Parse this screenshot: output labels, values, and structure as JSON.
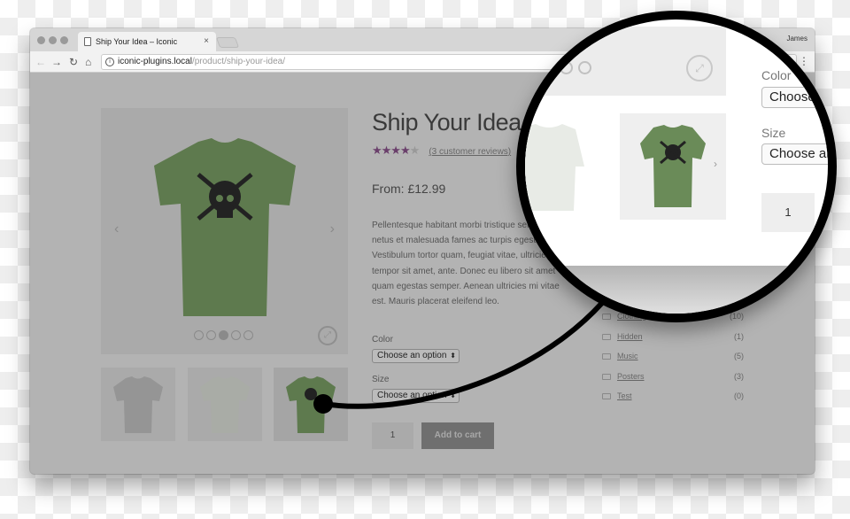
{
  "browser": {
    "tab_title": "Ship Your Idea – Iconic",
    "tab_close": "×",
    "profile_name": "James",
    "url_host": "iconic-plugins.local",
    "url_path": "/product/ship-your-idea/",
    "icons": {
      "back": "←",
      "forward": "→",
      "reload": "↻",
      "home": "⌂",
      "info": "i",
      "menu": "⋮"
    }
  },
  "product": {
    "title": "Ship Your Idea",
    "rating": 4.33,
    "rating_max": 5,
    "stars_filled": "★★★★",
    "stars_half": "★",
    "stars_empty": "",
    "reviews_link": "(3 customer reviews)",
    "price": "From: £12.99",
    "description": "Pellentesque habitant morbi tristique senectus et netus et malesuada fames ac turpis egestas. Vestibulum tortor quam, feugiat vitae, ultricies eget, tempor sit amet, ante. Donec eu libero sit amet quam egestas semper. Aenean ultricies mi vitae est. Mauris placerat eleifend leo.",
    "color_label": "Color",
    "color_value": "Choose an option",
    "size_label": "Size",
    "size_value": "Choose an option",
    "select_arrow": "⬍",
    "quantity": "1",
    "add_to_cart": "Add to cart"
  },
  "gallery": {
    "prev_arrow": "‹",
    "next_arrow": "›",
    "zoom_icon": "⤢",
    "slide_count": 5,
    "active_slide": 3,
    "shirt_color": "#5e7a4e",
    "thumbnails": [
      {
        "name": "grey-shirt",
        "color": "#959595"
      },
      {
        "name": "white-shirt",
        "color": "#a9aca6"
      },
      {
        "name": "green-shirt",
        "color": "#5e7a4e"
      }
    ]
  },
  "categories": [
    {
      "name": "Clothing",
      "count": "(10)"
    },
    {
      "name": "Hidden",
      "count": "(1)"
    },
    {
      "name": "Music",
      "count": "(5)"
    },
    {
      "name": "Posters",
      "count": "(3)"
    },
    {
      "name": "Test",
      "count": "(0)"
    }
  ],
  "magnifier": {
    "color_label": "Color",
    "color_value": "Choose an option",
    "size_label": "Size",
    "size_value": "Choose an option",
    "quantity": "1",
    "next_arrow": "›",
    "zoom_icon": "⤢"
  },
  "colors": {
    "star": "#6a3f6b",
    "overlay": "#b3b3b3",
    "shirt_green": "#5e7a4e"
  }
}
